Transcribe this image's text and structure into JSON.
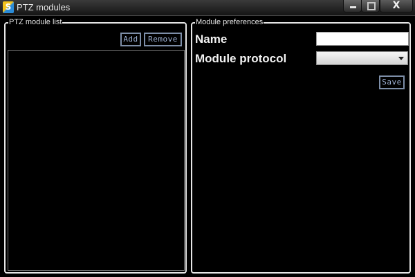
{
  "window": {
    "title": "PTZ modules",
    "app_icon": "app-logo-icon",
    "controls": {
      "minimize_icon": "minimize-icon",
      "maximize_icon": "maximize-icon",
      "close_glyph": "X"
    }
  },
  "module_list_group": {
    "legend": "PTZ module list",
    "add_label": "Add",
    "remove_label": "Remove",
    "items": []
  },
  "preferences_group": {
    "legend": "Module preferences",
    "name_label": "Name",
    "name_value": "",
    "protocol_label": "Module protocol",
    "protocol_value": "",
    "save_label": "Save"
  },
  "colors": {
    "background": "#000000",
    "text": "#f2f2f2",
    "button_border": "#7d8ea8",
    "button_text": "#9fb3d6"
  }
}
